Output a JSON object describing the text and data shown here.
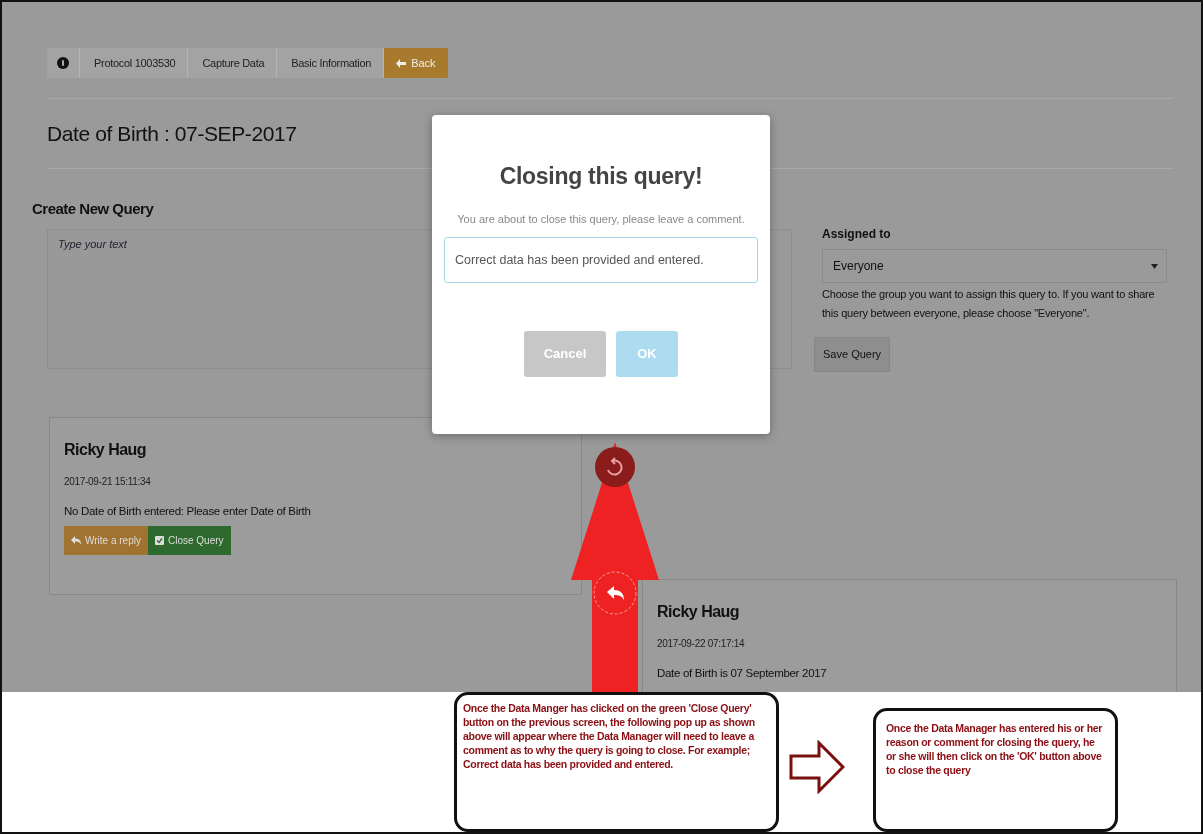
{
  "breadcrumb": {
    "items": [
      {
        "label": "Protocol 1003530"
      },
      {
        "label": "Capture Data"
      },
      {
        "label": "Basic Information"
      }
    ],
    "back": {
      "label": "Back"
    }
  },
  "page_title": "Date of Birth : 07-SEP-2017",
  "create_query": {
    "heading": "Create New Query",
    "placeholder": "Type your text"
  },
  "assign": {
    "label": "Assigned to",
    "value": "Everyone",
    "help": "Choose the group you want to assign this query to. If you want to share this query between everyone, please choose \"Everyone\".",
    "save_button": "Save Query"
  },
  "comments": [
    {
      "author": "Ricky Haug",
      "timestamp": "2017-09-21 15:11:34",
      "text": "No Date of Birth entered: Please enter Date of Birth",
      "actions": [
        {
          "label": "Write a reply",
          "kind": "reply"
        },
        {
          "label": "Close Query",
          "kind": "close"
        }
      ]
    },
    {
      "author": "Ricky Haug",
      "timestamp": "2017-09-22 07:17:14",
      "text": "Date of Birth is 07 September 2017"
    }
  ],
  "modal": {
    "title": "Closing this query!",
    "message": "You are about to close this query, please leave a comment.",
    "value": "Correct data has been provided and entered.",
    "buttons": [
      {
        "label": "Cancel",
        "kind": "cancel"
      },
      {
        "label": "OK",
        "kind": "confirm"
      }
    ]
  },
  "annotations": [
    {
      "text": "Once the Data Manger has clicked on the green 'Close Query' button on the previous screen, the following pop up as shown above will appear where the Data Manager will need to leave a comment as to why the query is going to close. For example; Correct data has been provided and entered."
    },
    {
      "text": "Once the Data Manager has entered his or her reason or comment for closing the query, he or she will then click on the 'OK' button above to close the query"
    }
  ]
}
